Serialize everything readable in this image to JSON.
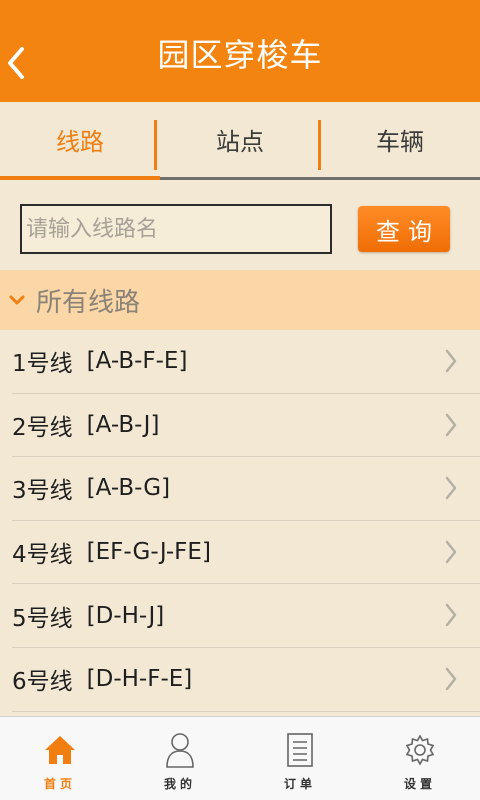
{
  "header": {
    "title": "园区穿梭车",
    "back_icon": "chevron-left-icon"
  },
  "tabs": [
    {
      "label": "线路",
      "active": true
    },
    {
      "label": "站点",
      "active": false
    },
    {
      "label": "车辆",
      "active": false
    }
  ],
  "search": {
    "placeholder": "请输入线路名",
    "value": "",
    "button_label": "查询"
  },
  "section": {
    "label": "所有线路",
    "icon": "chevron-down-icon"
  },
  "routes": [
    {
      "name": "1号线",
      "path": "[A-B-F-E]"
    },
    {
      "name": "2号线",
      "path": "[A-B-J]"
    },
    {
      "name": "3号线",
      "path": "[A-B-G]"
    },
    {
      "name": "4号线",
      "path": "[EF-G-J-FE]"
    },
    {
      "name": "5号线",
      "path": "[D-H-J]"
    },
    {
      "name": "6号线",
      "path": "[D-H-F-E]"
    }
  ],
  "tabbar": [
    {
      "label": "首页",
      "icon": "home-icon",
      "active": true
    },
    {
      "label": "我的",
      "icon": "user-icon",
      "active": false
    },
    {
      "label": "订单",
      "icon": "document-icon",
      "active": false
    },
    {
      "label": "设置",
      "icon": "gear-icon",
      "active": false
    }
  ],
  "colors": {
    "accent": "#f3840f",
    "background": "#f3e8d3",
    "section_bg": "#fbd6a6"
  }
}
